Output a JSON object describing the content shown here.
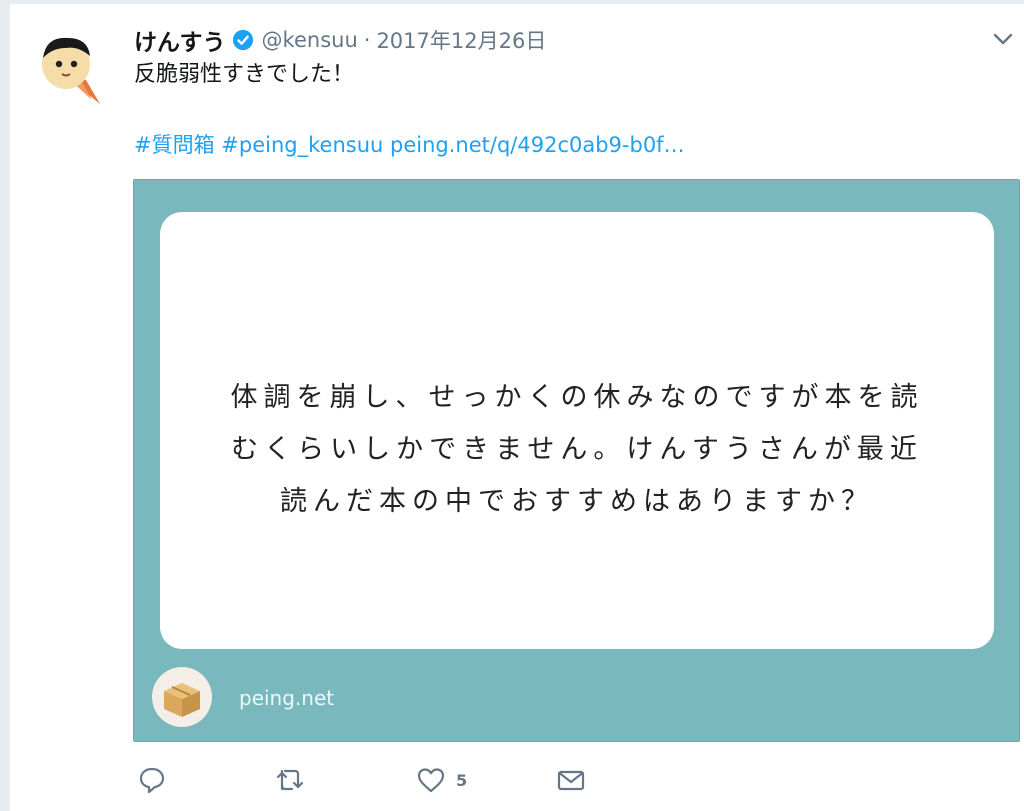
{
  "tweet": {
    "display_name": "けんすう",
    "handle": "@kensuu",
    "separator": "·",
    "timestamp": "2017年12月26日",
    "text": "反脆弱性すきでした！",
    "hashtag_1": "#質問箱",
    "hashtag_2": "#peing_kensuu",
    "link": "peing.net/q/492c0ab9-b0f…"
  },
  "card": {
    "question_lines": [
      "体調を崩し、せっかくの休みなのですが本を読",
      "むくらいしかできません。けんすうさんが最近",
      "読んだ本の中でおすすめはありますか？"
    ],
    "domain": "peing.net"
  },
  "actions": {
    "like_count": "5"
  },
  "icons": {
    "verified": "verified-badge-icon",
    "menu": "chevron-down-icon",
    "reply": "reply-icon",
    "retweet": "retweet-icon",
    "like": "heart-icon",
    "message": "envelope-icon"
  },
  "colors": {
    "accent": "#1da1f2",
    "card_background": "#79b8bc",
    "secondary_text": "#657786"
  }
}
